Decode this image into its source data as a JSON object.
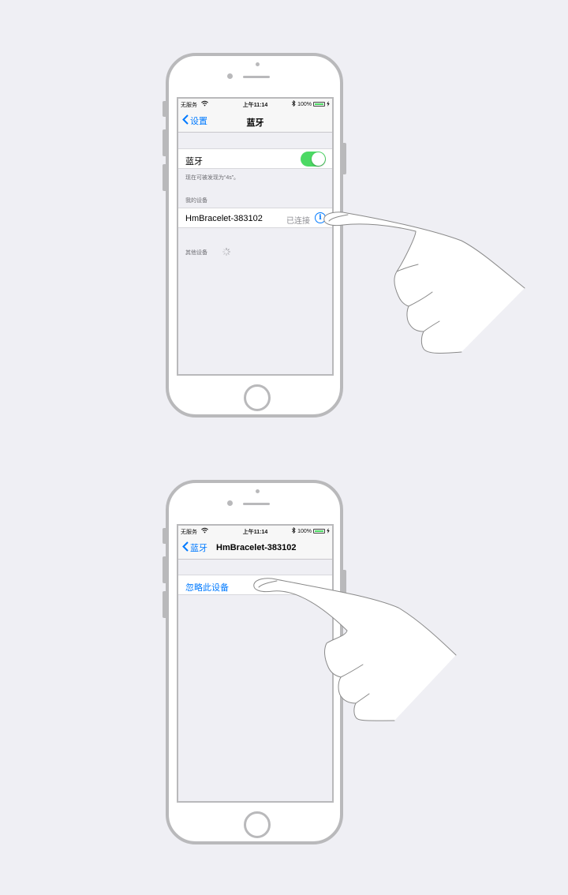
{
  "colors": {
    "background": "#efeff4",
    "accent": "#007aff",
    "toggle_on": "#4cd964",
    "frame": "#b9b9bb"
  },
  "screen1": {
    "status_bar": {
      "carrier": "无服务",
      "time": "上午11:14",
      "battery": "100%"
    },
    "nav": {
      "back_label": "设置",
      "title": "蓝牙"
    },
    "bluetooth_toggle": {
      "label": "蓝牙",
      "on": true
    },
    "discoverable_text": "现在可被发现为“4s”。",
    "my_devices_header": "我的设备",
    "device": {
      "name": "HmBracelet-383102",
      "status": "已连接",
      "info_icon": "info-icon"
    },
    "other_devices_header": "其他设备"
  },
  "screen2": {
    "status_bar": {
      "carrier": "无服务",
      "time": "上午11:14",
      "battery": "100%"
    },
    "nav": {
      "back_label": "蓝牙",
      "title": "HmBracelet-383102"
    },
    "forget_button": "忽略此设备"
  }
}
